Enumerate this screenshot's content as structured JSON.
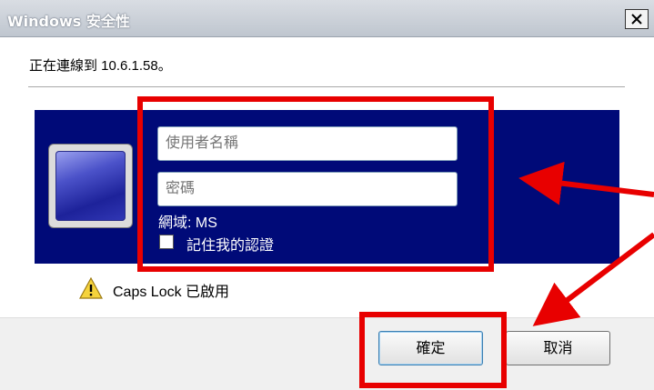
{
  "window": {
    "title": "Windows 安全性",
    "connecting_text": "正在連線到 10.6.1.58。"
  },
  "credentials": {
    "username_placeholder": "使用者名稱",
    "password_placeholder": "密碼",
    "domain_text": "網域: MS",
    "remember_label": "記住我的認證",
    "remember_checked": false
  },
  "warning": {
    "caps_lock_text": "Caps Lock 已啟用",
    "icon": "warning-icon"
  },
  "buttons": {
    "ok_label": "確定",
    "cancel_label": "取消"
  },
  "colors": {
    "panel_background": "#000a78",
    "annotation": "#e80000"
  }
}
